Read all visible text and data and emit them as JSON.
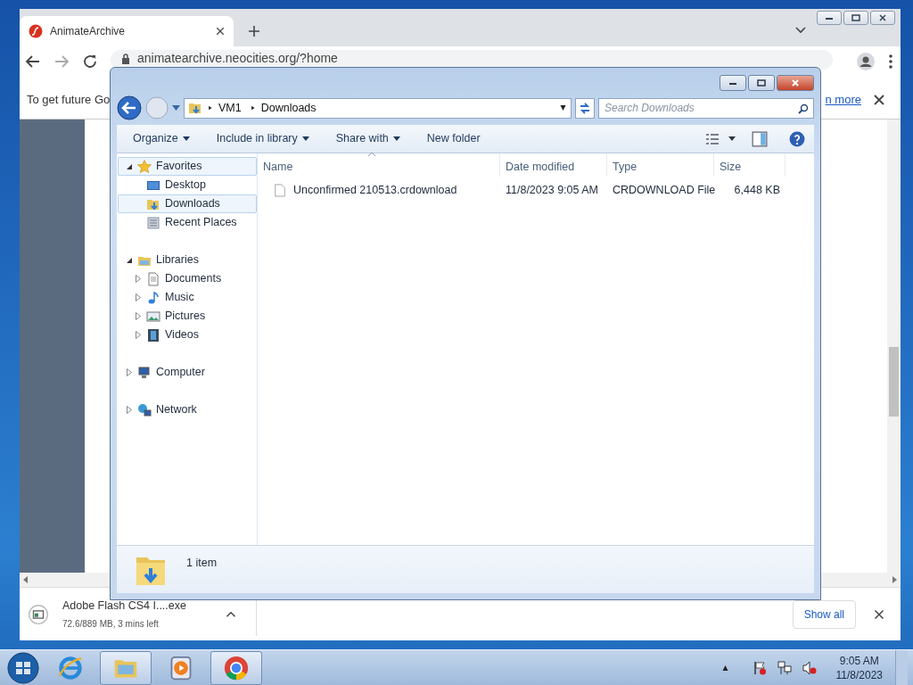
{
  "browser": {
    "tab": {
      "title": "AnimateArchive",
      "selected": true
    },
    "url": "animatearchive.neocities.org/?home",
    "infobar": {
      "text": "To get future Go",
      "link": "n more"
    }
  },
  "explorer": {
    "breadcrumb": [
      "VM1",
      "Downloads"
    ],
    "search": {
      "placeholder": "Search Downloads"
    },
    "toolbar": [
      {
        "label": "Organize",
        "dropdown": true
      },
      {
        "label": "Include in library",
        "dropdown": true
      },
      {
        "label": "Share with",
        "dropdown": true
      },
      {
        "label": "New folder",
        "dropdown": false
      }
    ],
    "nav_tree": [
      {
        "label": "Favorites",
        "kind": "star",
        "expanded": true,
        "selected": true,
        "children": [
          {
            "label": "Desktop",
            "kind": "desktop",
            "selected": false
          },
          {
            "label": "Downloads",
            "kind": "downloads",
            "selected": true
          },
          {
            "label": "Recent Places",
            "kind": "recent",
            "selected": false
          }
        ]
      },
      {
        "label": "Libraries",
        "kind": "libraries",
        "expanded": true,
        "selected": false,
        "children": [
          {
            "label": "Documents",
            "kind": "documents",
            "expanded": false,
            "selected": false
          },
          {
            "label": "Music",
            "kind": "music",
            "expanded": false,
            "selected": false
          },
          {
            "label": "Pictures",
            "kind": "pictures",
            "expanded": false,
            "selected": false
          },
          {
            "label": "Videos",
            "kind": "videos",
            "expanded": false,
            "selected": false
          }
        ]
      },
      {
        "label": "Computer",
        "kind": "computer",
        "expanded": false,
        "selected": false
      },
      {
        "label": "Network",
        "kind": "network",
        "expanded": false,
        "selected": false
      }
    ],
    "columns": [
      {
        "label": "Name",
        "sorted": true
      },
      {
        "label": "Date modified",
        "sorted": false
      },
      {
        "label": "Type",
        "sorted": false
      },
      {
        "label": "Size",
        "sorted": false
      }
    ],
    "files": [
      {
        "name": "Unconfirmed 210513.crdownload",
        "date": "11/8/2023 9:05 AM",
        "type": "CRDOWNLOAD File",
        "size": "6,448 KB"
      }
    ],
    "status": "1 item"
  },
  "download_shelf": {
    "items": [
      {
        "name": "Adobe Flash CS4 I....exe",
        "status": "72.6/889 MB, 3 mins left"
      }
    ],
    "show_all": "Show all"
  },
  "taskbar": {
    "apps": [
      {
        "kind": "ie",
        "active": false
      },
      {
        "kind": "explorer",
        "active": true
      },
      {
        "kind": "media",
        "active": false
      },
      {
        "kind": "chrome",
        "active": true
      }
    ],
    "clock": {
      "time": "9:05 AM",
      "date": "11/8/2023"
    }
  }
}
